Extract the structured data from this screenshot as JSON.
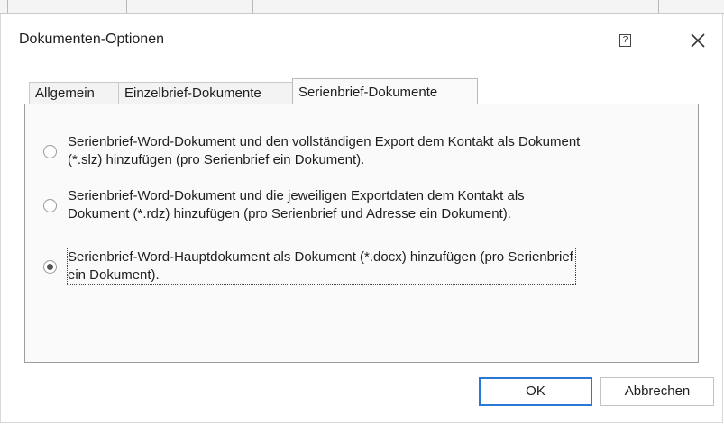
{
  "dialog": {
    "title": "Dokumenten-Optionen",
    "help_label": "?"
  },
  "tabs": [
    {
      "label": "Allgemein",
      "active": false
    },
    {
      "label": "Einzelbrief-Dokumente",
      "active": false
    },
    {
      "label": "Serienbrief-Dokumente",
      "active": true
    }
  ],
  "options": [
    {
      "line1": "Serienbrief-Word-Dokument und den vollständigen Export dem Kontakt als Dokument",
      "line2": "(*.slz) hinzufügen (pro Serienbrief ein Dokument).",
      "checked": false
    },
    {
      "line1": "Serienbrief-Word-Dokument und die jeweiligen Exportdaten dem Kontakt als",
      "line2": "Dokument (*.rdz) hinzufügen (pro Serienbrief und Adresse ein Dokument).",
      "checked": false
    },
    {
      "line1": "Serienbrief-Word-Hauptdokument als Dokument (*.docx) hinzufügen (pro Serienbrief",
      "line2": "ein Dokument).",
      "checked": true
    }
  ],
  "buttons": {
    "ok": "OK",
    "cancel": "Abbrechen"
  },
  "colors": {
    "accent": "#2a78d6",
    "panel_bg": "#fafafa"
  }
}
